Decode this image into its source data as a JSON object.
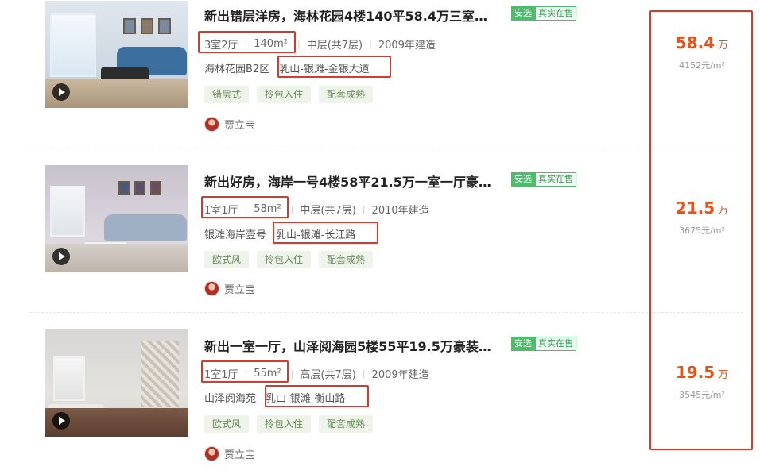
{
  "listings": [
    {
      "title": "新出错层洋房，海林花园4楼140平58.4万三室两…",
      "badge_anxuan": "安选",
      "badge_real": "真实在售",
      "layout": "3室2厅",
      "area": "140m²",
      "floor": "中层(共7层)",
      "year": "2009年建造",
      "community": "海林花园B2区",
      "district": "乳山-银滩-金银大道",
      "tags": [
        "错层式",
        "拎包入住",
        "配套成熟"
      ],
      "agent": "贾立宝",
      "price": "58.4",
      "price_unit": "万",
      "unit_price": "4152元/m²"
    },
    {
      "title": "新出好房，海岸一号4楼58平21.5万一室一厅豪装…",
      "badge_anxuan": "安选",
      "badge_real": "真实在售",
      "layout": "1室1厅",
      "area": "58m²",
      "floor": "中层(共7层)",
      "year": "2010年建造",
      "community": "银滩海岸壹号",
      "district": "乳山-银滩-长江路",
      "tags": [
        "欧式风",
        "拎包入住",
        "配套成熟"
      ],
      "agent": "贾立宝",
      "price": "21.5",
      "price_unit": "万",
      "unit_price": "3675元/m²"
    },
    {
      "title": "新出一室一厅，山泽阅海园5楼55平19.5万豪装拎…",
      "badge_anxuan": "安选",
      "badge_real": "真实在售",
      "layout": "1室1厅",
      "area": "55m²",
      "floor": "高层(共7层)",
      "year": "2009年建造",
      "community": "山泽阅海苑",
      "district": "乳山-银滩-衡山路",
      "tags": [
        "欧式风",
        "拎包入住",
        "配套成熟"
      ],
      "agent": "贾立宝",
      "price": "19.5",
      "price_unit": "万",
      "unit_price": "3545元/m²"
    }
  ],
  "colors": {
    "price": "#e3531b",
    "highlight_box": "#d9382a",
    "badge_green": "#4cbd6a",
    "tag_bg": "#eef4ea"
  },
  "icons": {
    "play": "play-icon",
    "avatar": "agent-avatar"
  }
}
